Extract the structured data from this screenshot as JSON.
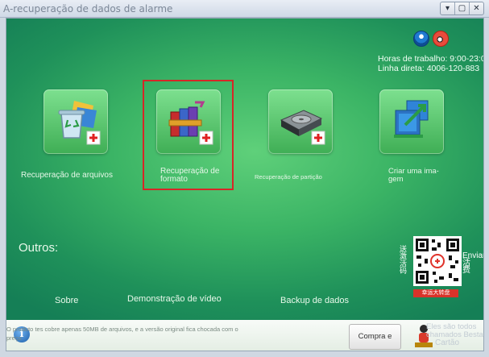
{
  "window": {
    "title": "A-recuperação de dados de alarme",
    "btn_min": "▾",
    "btn_restore": "▢",
    "btn_close": "✕"
  },
  "contact": {
    "hours": "Horas de trabalho: 9:00-23:0",
    "phone": "Linha direta: 4006-120-883"
  },
  "tiles": [
    {
      "label_1": "Recuperação de arquivos",
      "label_2": "",
      "icon": "recycle-bin-icon"
    },
    {
      "label_1": "Recuperação de",
      "label_2": "formato",
      "icon": "winrar-books-icon"
    },
    {
      "label_1": "Recuperação de partição",
      "label_2": "",
      "icon": "hard-drive-icon"
    },
    {
      "label_1": "Criar uma ima-",
      "label_2": "gem",
      "icon": "disk-image-icon"
    }
  ],
  "outros": {
    "heading": "Outros:",
    "links": [
      "Sobre",
      "Demonstração de vídeo",
      "Backup de dados"
    ]
  },
  "promo": {
    "left_chars": [
      "送",
      "激",
      "活",
      "码"
    ],
    "right_1": "Enviar",
    "right_2": "活",
    "right_3": "费",
    "tag": "幸运大转盘"
  },
  "footer": {
    "note": "O produto tes cobre apenas 50MB de arquivos, e a versão original fica chocada com o preço",
    "buy_button": "Compra e registro",
    "fans": "Eles são todos",
    "fans_2": "chamados Besta",
    "brand": "Cartão"
  },
  "colors": {
    "accent_selection": "#d62727",
    "background_green": "#3bb465"
  }
}
